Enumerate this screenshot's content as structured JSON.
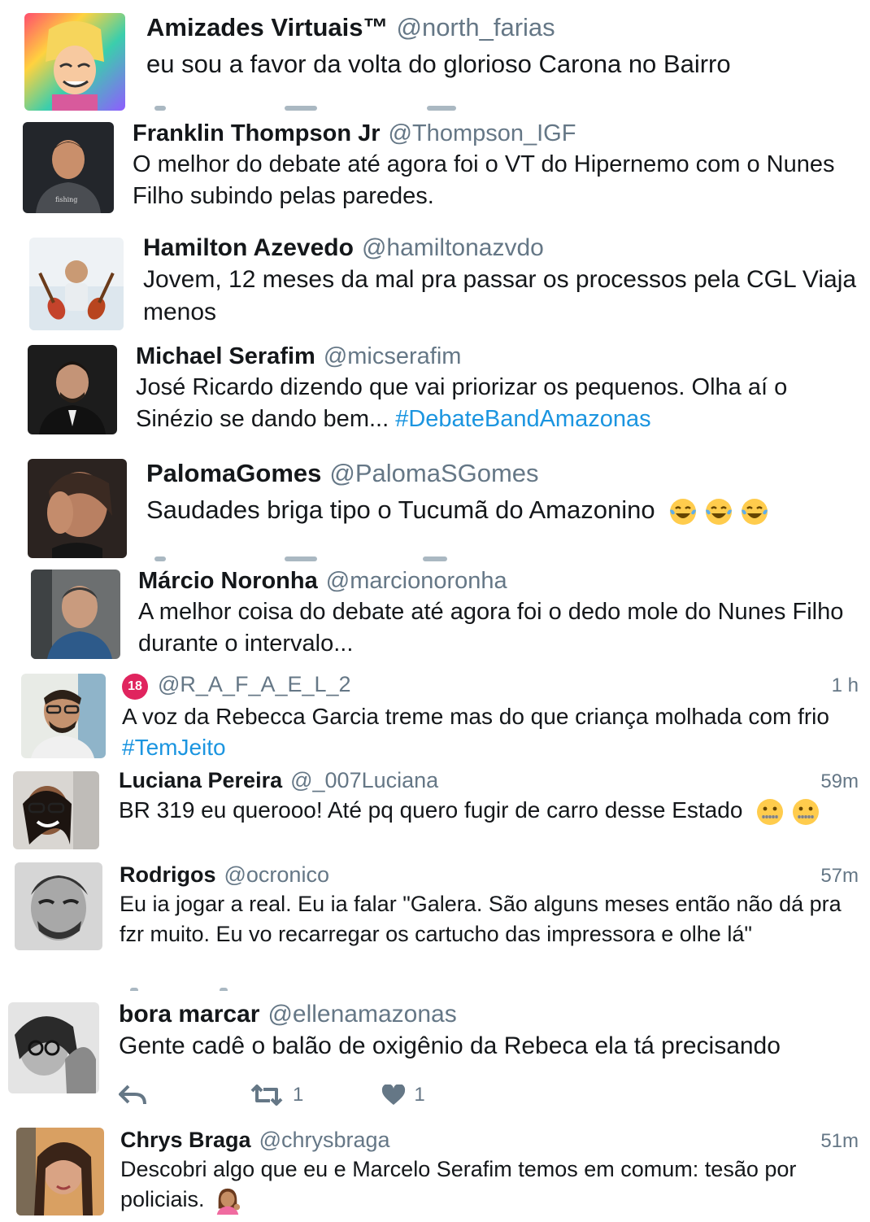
{
  "tweets": [
    {
      "name": "Amizades Virtuais™",
      "handle": "@north_farias",
      "text": "eu sou a favor da volta do glorioso Carona no Bairro"
    },
    {
      "name": "Franklin Thompson Jr",
      "handle": "@Thompson_IGF",
      "text": "O melhor do debate até agora foi o VT do Hipernemo com o Nunes Filho subindo pelas paredes."
    },
    {
      "name": "Hamilton Azevedo",
      "handle": "@hamiltonazvdo",
      "text": "Jovem, 12 meses da mal pra passar os processos pela CGL Viaja menos"
    },
    {
      "name": "Michael Serafim",
      "handle": "@micserafim",
      "text": "José Ricardo dizendo que vai priorizar os pequenos. Olha aí o Sinézio se dando bem... ",
      "hashtag": "#DebateBandAmazonas"
    },
    {
      "name": "PalomaGomes",
      "handle": "@PalomaSGomes",
      "text": "Saudades briga tipo o Tucumã do Amazonino"
    },
    {
      "name": "Márcio Noronha",
      "handle": "@marcionoronha",
      "text": "A melhor coisa do debate até agora foi o dedo mole do Nunes Filho durante o intervalo..."
    },
    {
      "badge": "18",
      "handle": "@R_A_F_A_E_L_2",
      "time": "1 h",
      "text": "A voz da Rebecca Garcia treme mas do que criança molhada com frio ",
      "hashtag": "#TemJeito"
    },
    {
      "name": "Luciana Pereira",
      "handle": "@_007Luciana",
      "time": "59m",
      "text": "BR 319 eu querooo! Até pq quero fugir de carro desse Estado"
    },
    {
      "name": "Rodrigos",
      "handle": "@ocronico",
      "time": "57m",
      "text": "Eu ia jogar a real. Eu ia falar \"Galera. São alguns meses então não dá pra fzr muito. Eu vo recarregar os cartucho das impressora e olhe lá\""
    },
    {
      "name": "bora marcar",
      "handle": "@ellenamazonas",
      "text": "Gente cadê o balão de oxigênio da Rebeca ela tá precisando",
      "retweets": "1",
      "likes": "1"
    },
    {
      "name": "Chrys Braga",
      "handle": "@chrysbraga",
      "time": "51m",
      "text": "Descobri algo que eu e Marcelo Serafim temos em comum: tesão por policiais."
    }
  ],
  "colors": {
    "name": "#14171a",
    "handle": "#657786",
    "hashtag": "#1b95e0",
    "badge": "#e0245e"
  }
}
